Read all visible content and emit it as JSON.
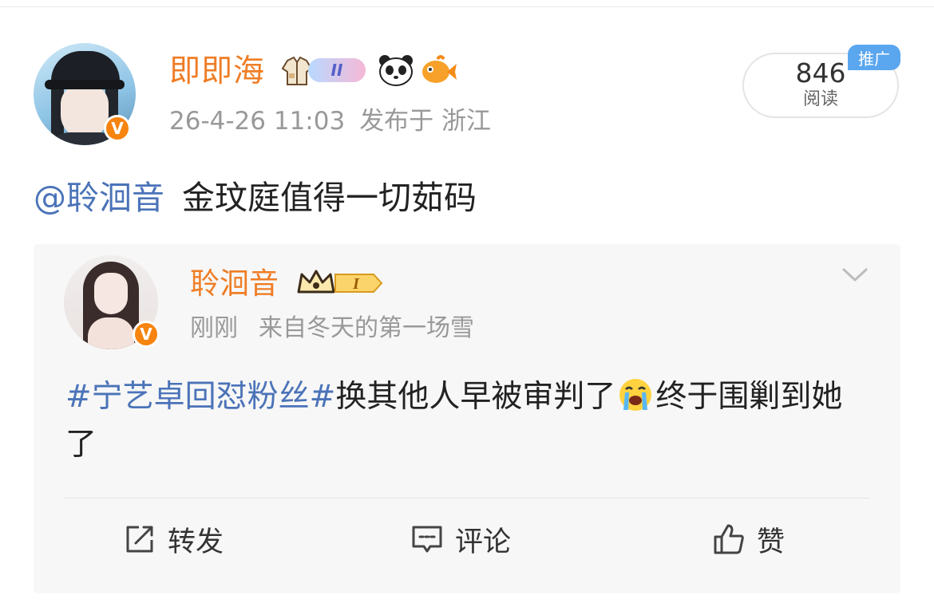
{
  "post": {
    "author_name": "即即海",
    "badges": {
      "gemini": "II"
    },
    "timestamp": "26-4-26 11:03",
    "source": "发布于 浙江",
    "read_count": "846",
    "read_label": "阅读",
    "promo_tag": "推广",
    "mention": "@聆洄音",
    "text": "金玟庭值得一切茹码"
  },
  "quote": {
    "author_name": "聆洄音",
    "level_badge": "I",
    "time": "刚刚",
    "source": "来自冬天的第一场雪",
    "topic": "#宁艺卓回怼粉丝#",
    "text_part1": "换其他人早被审判了",
    "text_part2": "终于围剿到她了",
    "verified_mark": "V"
  },
  "actions": {
    "repost": "转发",
    "comment": "评论",
    "like": "赞"
  },
  "colors": {
    "name_orange": "#ef7d26",
    "link_blue": "#4b73b8",
    "verified_orange": "#f7840f",
    "promo_blue": "#5aa6ef"
  },
  "icons": [
    "repost-icon",
    "comment-icon",
    "like-icon",
    "chevron-down-icon",
    "crying-emoji",
    "panda-icon",
    "fish-icon",
    "jacket-icon",
    "crown-badge"
  ]
}
